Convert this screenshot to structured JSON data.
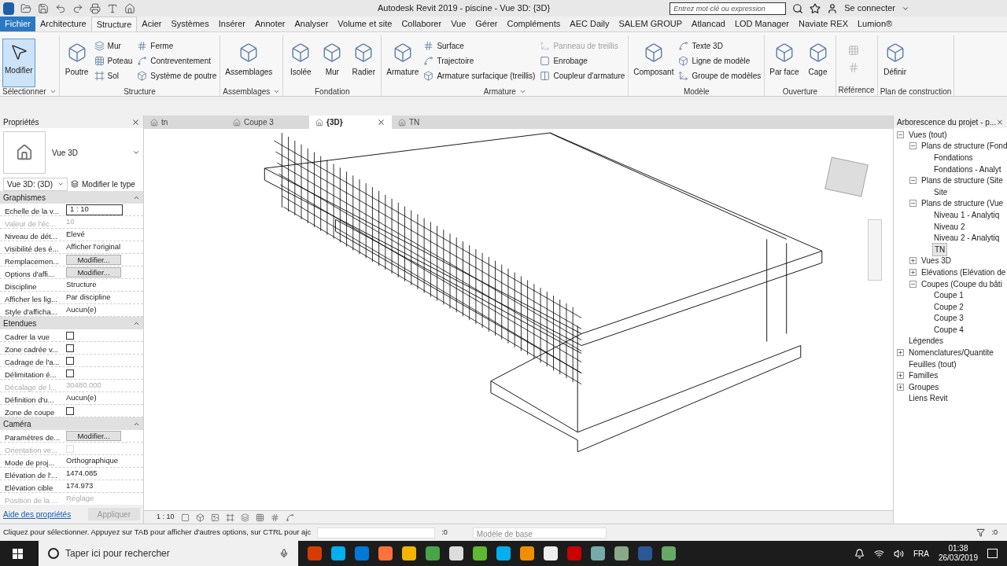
{
  "title_bar": {
    "title": "Autodesk Revit 2019 - piscine - Vue 3D: {3D}",
    "search_placeholder": "Entrez mot-clé ou expression",
    "sign_in": "Se connecter"
  },
  "menu_tabs": [
    {
      "label": "Fichier",
      "selected": false,
      "kind": "file"
    },
    {
      "label": "Architecture",
      "selected": false,
      "kind": "tab"
    },
    {
      "label": "Structure",
      "selected": true,
      "kind": "tab"
    },
    {
      "label": "Acier",
      "selected": false,
      "kind": "tab"
    },
    {
      "label": "Systèmes",
      "selected": false,
      "kind": "tab"
    },
    {
      "label": "Insérer",
      "selected": false,
      "kind": "tab"
    },
    {
      "label": "Annoter",
      "selected": false,
      "kind": "tab"
    },
    {
      "label": "Analyser",
      "selected": false,
      "kind": "tab"
    },
    {
      "label": "Volume et site",
      "selected": false,
      "kind": "tab"
    },
    {
      "label": "Collaborer",
      "selected": false,
      "kind": "tab"
    },
    {
      "label": "Vue",
      "selected": false,
      "kind": "tab"
    },
    {
      "label": "Gérer",
      "selected": false,
      "kind": "tab"
    },
    {
      "label": "Compléments",
      "selected": false,
      "kind": "tab"
    },
    {
      "label": "AEC Daily",
      "selected": false,
      "kind": "tab"
    },
    {
      "label": "SALEM GROUP",
      "selected": false,
      "kind": "tab"
    },
    {
      "label": "Atlancad",
      "selected": false,
      "kind": "tab"
    },
    {
      "label": "LOD Manager",
      "selected": false,
      "kind": "tab"
    },
    {
      "label": "Naviate REX",
      "selected": false,
      "kind": "tab"
    },
    {
      "label": "Lumion®",
      "selected": false,
      "kind": "tab"
    }
  ],
  "ribbon": [
    {
      "title": "Sélectionner",
      "menu": true,
      "tools": [
        {
          "label": "Modifier",
          "kind": "large",
          "selected": true,
          "disabled": false
        }
      ]
    },
    {
      "title": "Structure",
      "menu": false,
      "tools": [
        {
          "label": "Poutre",
          "kind": "large",
          "selected": false,
          "disabled": false
        },
        {
          "label": "Mur",
          "kind": "small",
          "selected": false,
          "disabled": false
        },
        {
          "label": "Poteau",
          "kind": "small",
          "selected": false,
          "disabled": false
        },
        {
          "label": "Sol",
          "kind": "small",
          "selected": false,
          "disabled": false
        },
        {
          "label": "Ferme",
          "kind": "small",
          "selected": false,
          "disabled": false
        },
        {
          "label": "Contreventement",
          "kind": "small",
          "selected": false,
          "disabled": false
        },
        {
          "label": "Système de poutre",
          "kind": "small",
          "selected": false,
          "disabled": false
        }
      ]
    },
    {
      "title": "Assemblages",
      "menu": true,
      "tools": [
        {
          "label": "Assemblages",
          "kind": "large",
          "selected": false,
          "disabled": false
        }
      ]
    },
    {
      "title": "Fondation",
      "menu": false,
      "tools": [
        {
          "label": "Isolée",
          "kind": "large",
          "selected": false,
          "disabled": false
        },
        {
          "label": "Mur",
          "kind": "large",
          "selected": false,
          "disabled": false
        },
        {
          "label": "Radier",
          "kind": "large",
          "selected": false,
          "disabled": false
        }
      ]
    },
    {
      "title": "Armature",
      "menu": true,
      "tools": [
        {
          "label": "Armature",
          "kind": "large",
          "selected": false,
          "disabled": false
        },
        {
          "label": "Surface",
          "kind": "small",
          "selected": false,
          "disabled": false
        },
        {
          "label": "Trajectoire",
          "kind": "small",
          "selected": false,
          "disabled": false
        },
        {
          "label": "Armature  surfacique (treillis)",
          "kind": "small",
          "selected": false,
          "disabled": false
        },
        {
          "label": "Panneau  de treillis",
          "kind": "small",
          "selected": false,
          "disabled": true
        },
        {
          "label": "Enrobage",
          "kind": "small",
          "selected": false,
          "disabled": false
        },
        {
          "label": "Coupleur  d'armature",
          "kind": "small",
          "selected": false,
          "disabled": false
        }
      ]
    },
    {
      "title": "Modèle",
      "menu": false,
      "tools": [
        {
          "label": "Composant",
          "kind": "large",
          "selected": false,
          "disabled": false
        },
        {
          "label": "Texte 3D",
          "kind": "small",
          "selected": false,
          "disabled": false
        },
        {
          "label": "Ligne de modèle",
          "kind": "small",
          "selected": false,
          "disabled": false
        },
        {
          "label": "Groupe de modèles",
          "kind": "small",
          "selected": false,
          "disabled": false
        }
      ]
    },
    {
      "title": "Ouverture",
      "menu": false,
      "tools": [
        {
          "label": "Par face",
          "kind": "large",
          "selected": false,
          "disabled": false
        },
        {
          "label": "Cage",
          "kind": "large",
          "selected": false,
          "disabled": false
        }
      ]
    },
    {
      "title": "Référence",
      "menu": false
    },
    {
      "title": "Plan de construction",
      "menu": false,
      "tools": [
        {
          "label": "Définir",
          "kind": "large",
          "selected": false,
          "disabled": false
        }
      ]
    }
  ],
  "properties": {
    "title": "Propriétés",
    "type_name": "Vue 3D",
    "view_selector": "Vue 3D: (3D)",
    "edit_type": "Modifier le type",
    "groups": [
      {
        "name": "Graphismes",
        "rows": [
          {
            "label": "Echelle de la v...",
            "value": "1 : 10",
            "kind": "input",
            "disabled": false
          },
          {
            "label": "Valeur de l'éc...",
            "value": "10",
            "kind": "text",
            "disabled": true
          },
          {
            "label": "Niveau de dét...",
            "value": "Elevé",
            "kind": "text",
            "disabled": false
          },
          {
            "label": "Visibilité des é...",
            "value": "Afficher l'original",
            "kind": "text",
            "disabled": false
          },
          {
            "label": "Remplacemen...",
            "value": "Modifier...",
            "kind": "button",
            "disabled": false
          },
          {
            "label": "Options d'affi...",
            "value": "Modifier...",
            "kind": "button",
            "disabled": false
          },
          {
            "label": "Discipline",
            "value": "Structure",
            "kind": "text",
            "disabled": false
          },
          {
            "label": "Afficher les lig...",
            "value": "Par discipline",
            "kind": "text",
            "disabled": false
          },
          {
            "label": "Style d'afficha...",
            "value": "Aucun(e)",
            "kind": "text",
            "disabled": false
          }
        ]
      },
      {
        "name": "Etendues",
        "rows": [
          {
            "label": "Cadrer la vue",
            "kind": "checkbox",
            "checked": false,
            "disabled": false
          },
          {
            "label": "Zone cadrée v...",
            "kind": "checkbox",
            "checked": false,
            "disabled": false
          },
          {
            "label": "Cadrage de l'a...",
            "kind": "checkbox",
            "checked": false,
            "disabled": false
          },
          {
            "label": "Délimitation é...",
            "kind": "checkbox",
            "checked": false,
            "disabled": false
          },
          {
            "label": "Décalage de l...",
            "value": "30480.000",
            "kind": "text",
            "disabled": true
          },
          {
            "label": "Définition d'u...",
            "value": "Aucun(e)",
            "kind": "text",
            "disabled": false
          },
          {
            "label": "Zone de coupe",
            "kind": "checkbox",
            "checked": false,
            "disabled": false
          }
        ]
      },
      {
        "name": "Caméra",
        "rows": [
          {
            "label": "Paramètres de...",
            "value": "Modifier...",
            "kind": "button",
            "disabled": false
          },
          {
            "label": "Orientation ve...",
            "kind": "checkbox",
            "checked": false,
            "disabled": true
          },
          {
            "label": "Mode de proj...",
            "value": "Orthographique",
            "kind": "text",
            "disabled": false
          },
          {
            "label": "Elévation de l'...",
            "value": "1474.085",
            "kind": "text",
            "disabled": false
          },
          {
            "label": "Elévation cible",
            "value": "174.973",
            "kind": "text",
            "disabled": false
          },
          {
            "label": "Position de la ...",
            "value": "Réglage",
            "kind": "text",
            "disabled": true
          }
        ]
      }
    ],
    "help_link": "Aide des propriétés",
    "apply": "Appliquer"
  },
  "view_tabs": [
    {
      "label": "tn",
      "selected": false
    },
    {
      "label": "Coupe 3",
      "selected": false
    },
    {
      "label": "{3D}",
      "selected": true
    },
    {
      "label": "TN",
      "selected": false
    }
  ],
  "view_bar": {
    "scale": "1 : 10"
  },
  "browser": {
    "title": "Arborescence du projet - p...",
    "tree": [
      {
        "label": "Vues (tout)",
        "expanded": true,
        "selected": false,
        "children": [
          {
            "label": "Plans de structure (Fond",
            "expanded": true,
            "selected": false,
            "children": [
              {
                "label": "Fondations",
                "selected": false
              },
              {
                "label": "Fondations - Analyt",
                "selected": false
              }
            ]
          },
          {
            "label": "Plans de structure (Site",
            "expanded": true,
            "selected": false,
            "children": [
              {
                "label": "Site",
                "selected": false
              }
            ]
          },
          {
            "label": "Plans de structure (Vue",
            "expanded": true,
            "selected": false,
            "children": [
              {
                "label": "Niveau 1 - Analytiq",
                "selected": false
              },
              {
                "label": "Niveau 2",
                "selected": false
              },
              {
                "label": "Niveau 2 - Analytiq",
                "selected": false
              },
              {
                "label": "TN",
                "selected": true
              }
            ]
          },
          {
            "label": "Vues 3D",
            "expanded": false,
            "selected": false
          },
          {
            "label": "Elévations (Elévation de",
            "expanded": false,
            "selected": false
          },
          {
            "label": "Coupes (Coupe du bâti",
            "expanded": true,
            "selected": false,
            "children": [
              {
                "label": "Coupe 1",
                "selected": false
              },
              {
                "label": "Coupe 2",
                "selected": false
              },
              {
                "label": "Coupe 3",
                "selected": false
              },
              {
                "label": "Coupe 4",
                "selected": false
              }
            ]
          }
        ]
      },
      {
        "label": "Légendes",
        "selected": false
      },
      {
        "label": "Nomenclatures/Quantite",
        "expanded": false,
        "selected": false
      },
      {
        "label": "Feuilles (tout)",
        "selected": false
      },
      {
        "label": "Familles",
        "expanded": false,
        "selected": false
      },
      {
        "label": "Groupes",
        "expanded": false,
        "selected": false
      },
      {
        "label": "Liens Revit",
        "selected": false
      }
    ]
  },
  "status_bar": {
    "message": "Cliquez pour sélectionner. Appuyez sur TAB pour afficher d'autres options, sur CTRL pour ajc",
    "count": ":0",
    "model": "Modèle de base",
    "filter_count": ":0"
  },
  "taskbar": {
    "search_placeholder": "Taper ici pour rechercher",
    "language": "FRA",
    "time": "01:38",
    "date": "26/03/2019"
  }
}
